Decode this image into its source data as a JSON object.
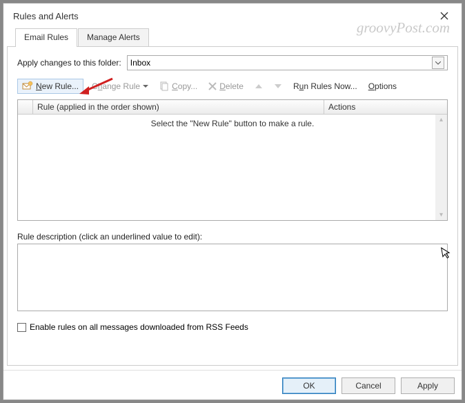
{
  "window": {
    "title": "Rules and Alerts"
  },
  "tabs": {
    "email_rules": "Email Rules",
    "manage_alerts": "Manage Alerts"
  },
  "apply": {
    "label": "Apply changes to this folder:",
    "selected": "Inbox"
  },
  "toolbar": {
    "new_rule_accel": "N",
    "new_rule_rest": "ew Rule...",
    "change_rule_accel": "h",
    "change_rule_pre": "C",
    "change_rule_post": "ange Rule",
    "copy_accel": "C",
    "copy_rest": "opy...",
    "delete_accel": "D",
    "delete_rest": "elete",
    "run_now_pre1": "R",
    "run_now_accel": "u",
    "run_now_rest": "n Rules Now...",
    "options_accel": "O",
    "options_rest": "ptions"
  },
  "list": {
    "col_rule": "Rule (applied in the order shown)",
    "col_actions": "Actions",
    "empty_msg": "Select the \"New Rule\" button to make a rule."
  },
  "description": {
    "label": "Rule description (click an underlined value to edit):"
  },
  "rss": {
    "label": "Enable rules on all messages downloaded from RSS Feeds"
  },
  "buttons": {
    "ok": "OK",
    "cancel": "Cancel",
    "apply": "Apply"
  },
  "watermark": "groovyPost.com"
}
